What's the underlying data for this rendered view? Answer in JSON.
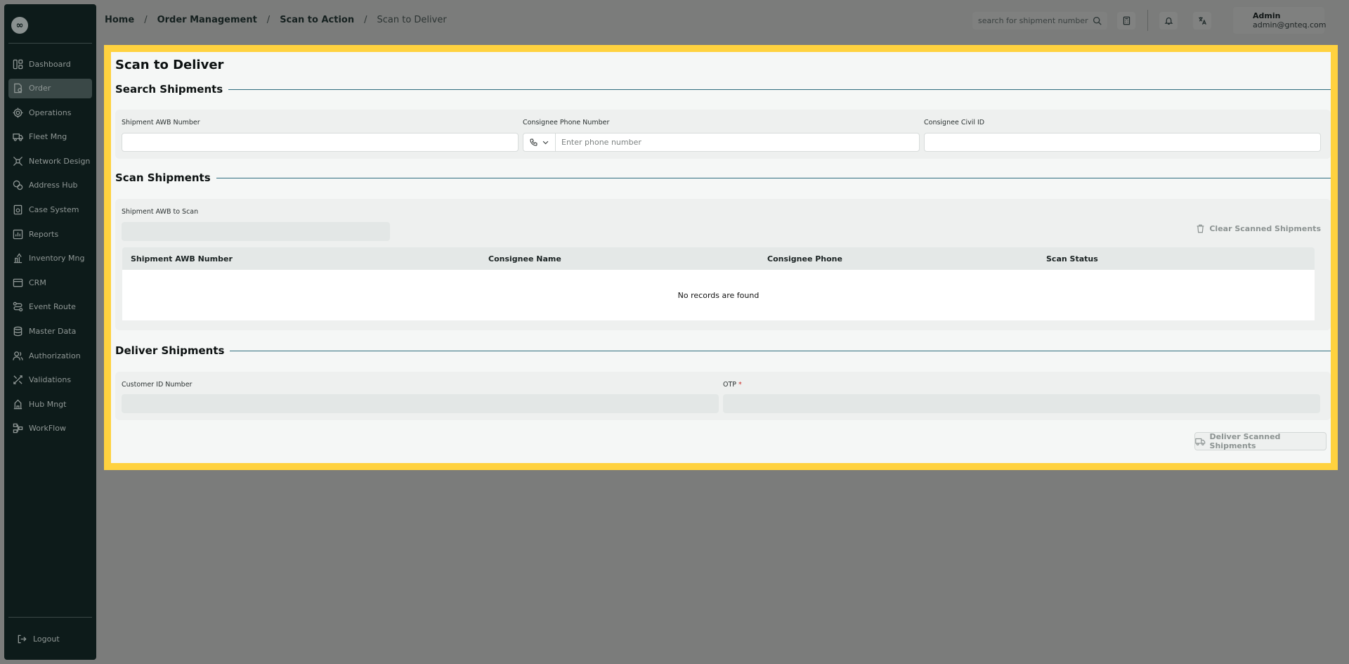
{
  "sidebar": {
    "logo_glyph": "∞",
    "items": [
      {
        "label": "Dashboard",
        "icon": "dashboard-icon",
        "active": false
      },
      {
        "label": "Order",
        "icon": "order-icon",
        "active": true
      },
      {
        "label": "Operations",
        "icon": "operations-icon",
        "active": false
      },
      {
        "label": "Fleet Mng",
        "icon": "truck-icon",
        "active": false
      },
      {
        "label": "Network Design",
        "icon": "network-icon",
        "active": false
      },
      {
        "label": "Address Hub",
        "icon": "address-icon",
        "active": false
      },
      {
        "label": "Case System",
        "icon": "case-icon",
        "active": false
      },
      {
        "label": "Reports",
        "icon": "reports-icon",
        "active": false
      },
      {
        "label": "Inventory Mng",
        "icon": "inventory-icon",
        "active": false
      },
      {
        "label": "CRM",
        "icon": "crm-icon",
        "active": false
      },
      {
        "label": "Event Route",
        "icon": "route-icon",
        "active": false
      },
      {
        "label": "Master Data",
        "icon": "database-icon",
        "active": false
      },
      {
        "label": "Authorization",
        "icon": "users-icon",
        "active": false
      },
      {
        "label": "Validations",
        "icon": "validations-icon",
        "active": false
      },
      {
        "label": "Hub Mngt",
        "icon": "hub-icon",
        "active": false
      },
      {
        "label": "WorkFlow",
        "icon": "workflow-icon",
        "active": false
      }
    ],
    "logout_label": "Logout"
  },
  "header": {
    "breadcrumb": [
      "Home",
      "Order Management",
      "Scan to Action",
      "Scan to Deliver"
    ],
    "search_placeholder": "search for shipment number",
    "user_name": "Admin",
    "user_email": "admin@gnteq.com"
  },
  "page": {
    "title": "Scan to Deliver",
    "search_section": {
      "title": "Search Shipments",
      "awb_label": "Shipment AWB Number",
      "awb_value": "",
      "phone_label": "Consignee Phone Number",
      "phone_placeholder": "Enter phone number",
      "civil_id_label": "Consignee Civil ID",
      "civil_id_value": ""
    },
    "scan_section": {
      "title": "Scan Shipments",
      "awb_scan_label": "Shipment AWB to Scan",
      "clear_label": "Clear Scanned Shipments",
      "columns": [
        "Shipment AWB Number",
        "Consignee Name",
        "Consignee Phone",
        "Scan Status"
      ],
      "rows": [],
      "empty_text": "No records are found"
    },
    "deliver_section": {
      "title": "Deliver Shipments",
      "customer_id_label": "Customer ID Number",
      "otp_label": "OTP",
      "otp_required": "*",
      "deliver_label": "Deliver Scanned Shipments"
    }
  },
  "colors": {
    "highlight": "#ffd23f",
    "sidebar_bg": "#0d1b1a",
    "accent_line": "#2f6d7e"
  }
}
